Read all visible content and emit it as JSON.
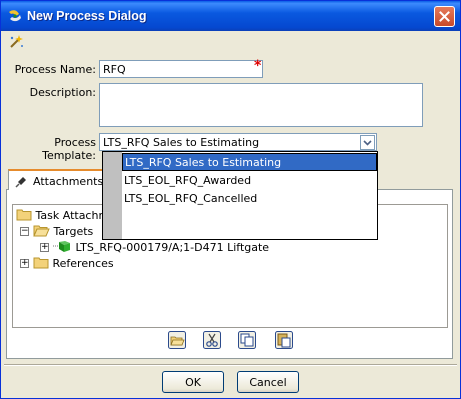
{
  "window": {
    "title": "New Process Dialog"
  },
  "form": {
    "process_name_label": "Process Name:",
    "process_name_value": "RFQ",
    "description_label": "Description:",
    "description_value": "",
    "template_label": "Process Template:",
    "template_value": "LTS_RFQ Sales to Estimating"
  },
  "dropdown": {
    "options": [
      "LTS_RFQ Sales to Estimating",
      "LTS_EOL_RFQ_Awarded",
      "LTS_EOL_RFQ_Cancelled"
    ],
    "selected_index": 0
  },
  "tabs": [
    {
      "label": "Attachments",
      "active": true
    }
  ],
  "tree": {
    "root": "Task Attachm",
    "targets": "Targets",
    "target_item": "LTS_RFQ-000179/A;1-D471 Liftgate",
    "references": "References"
  },
  "icons": [
    "wizard-icon",
    "open-icon",
    "cut-icon",
    "copy-icon",
    "paste-icon"
  ],
  "buttons": {
    "ok": "OK",
    "cancel": "Cancel"
  },
  "colors": {
    "title_bar": "#0a59e0",
    "selection": "#316ac5",
    "required": "#dd0000",
    "tab_accent": "#e68b2c"
  }
}
